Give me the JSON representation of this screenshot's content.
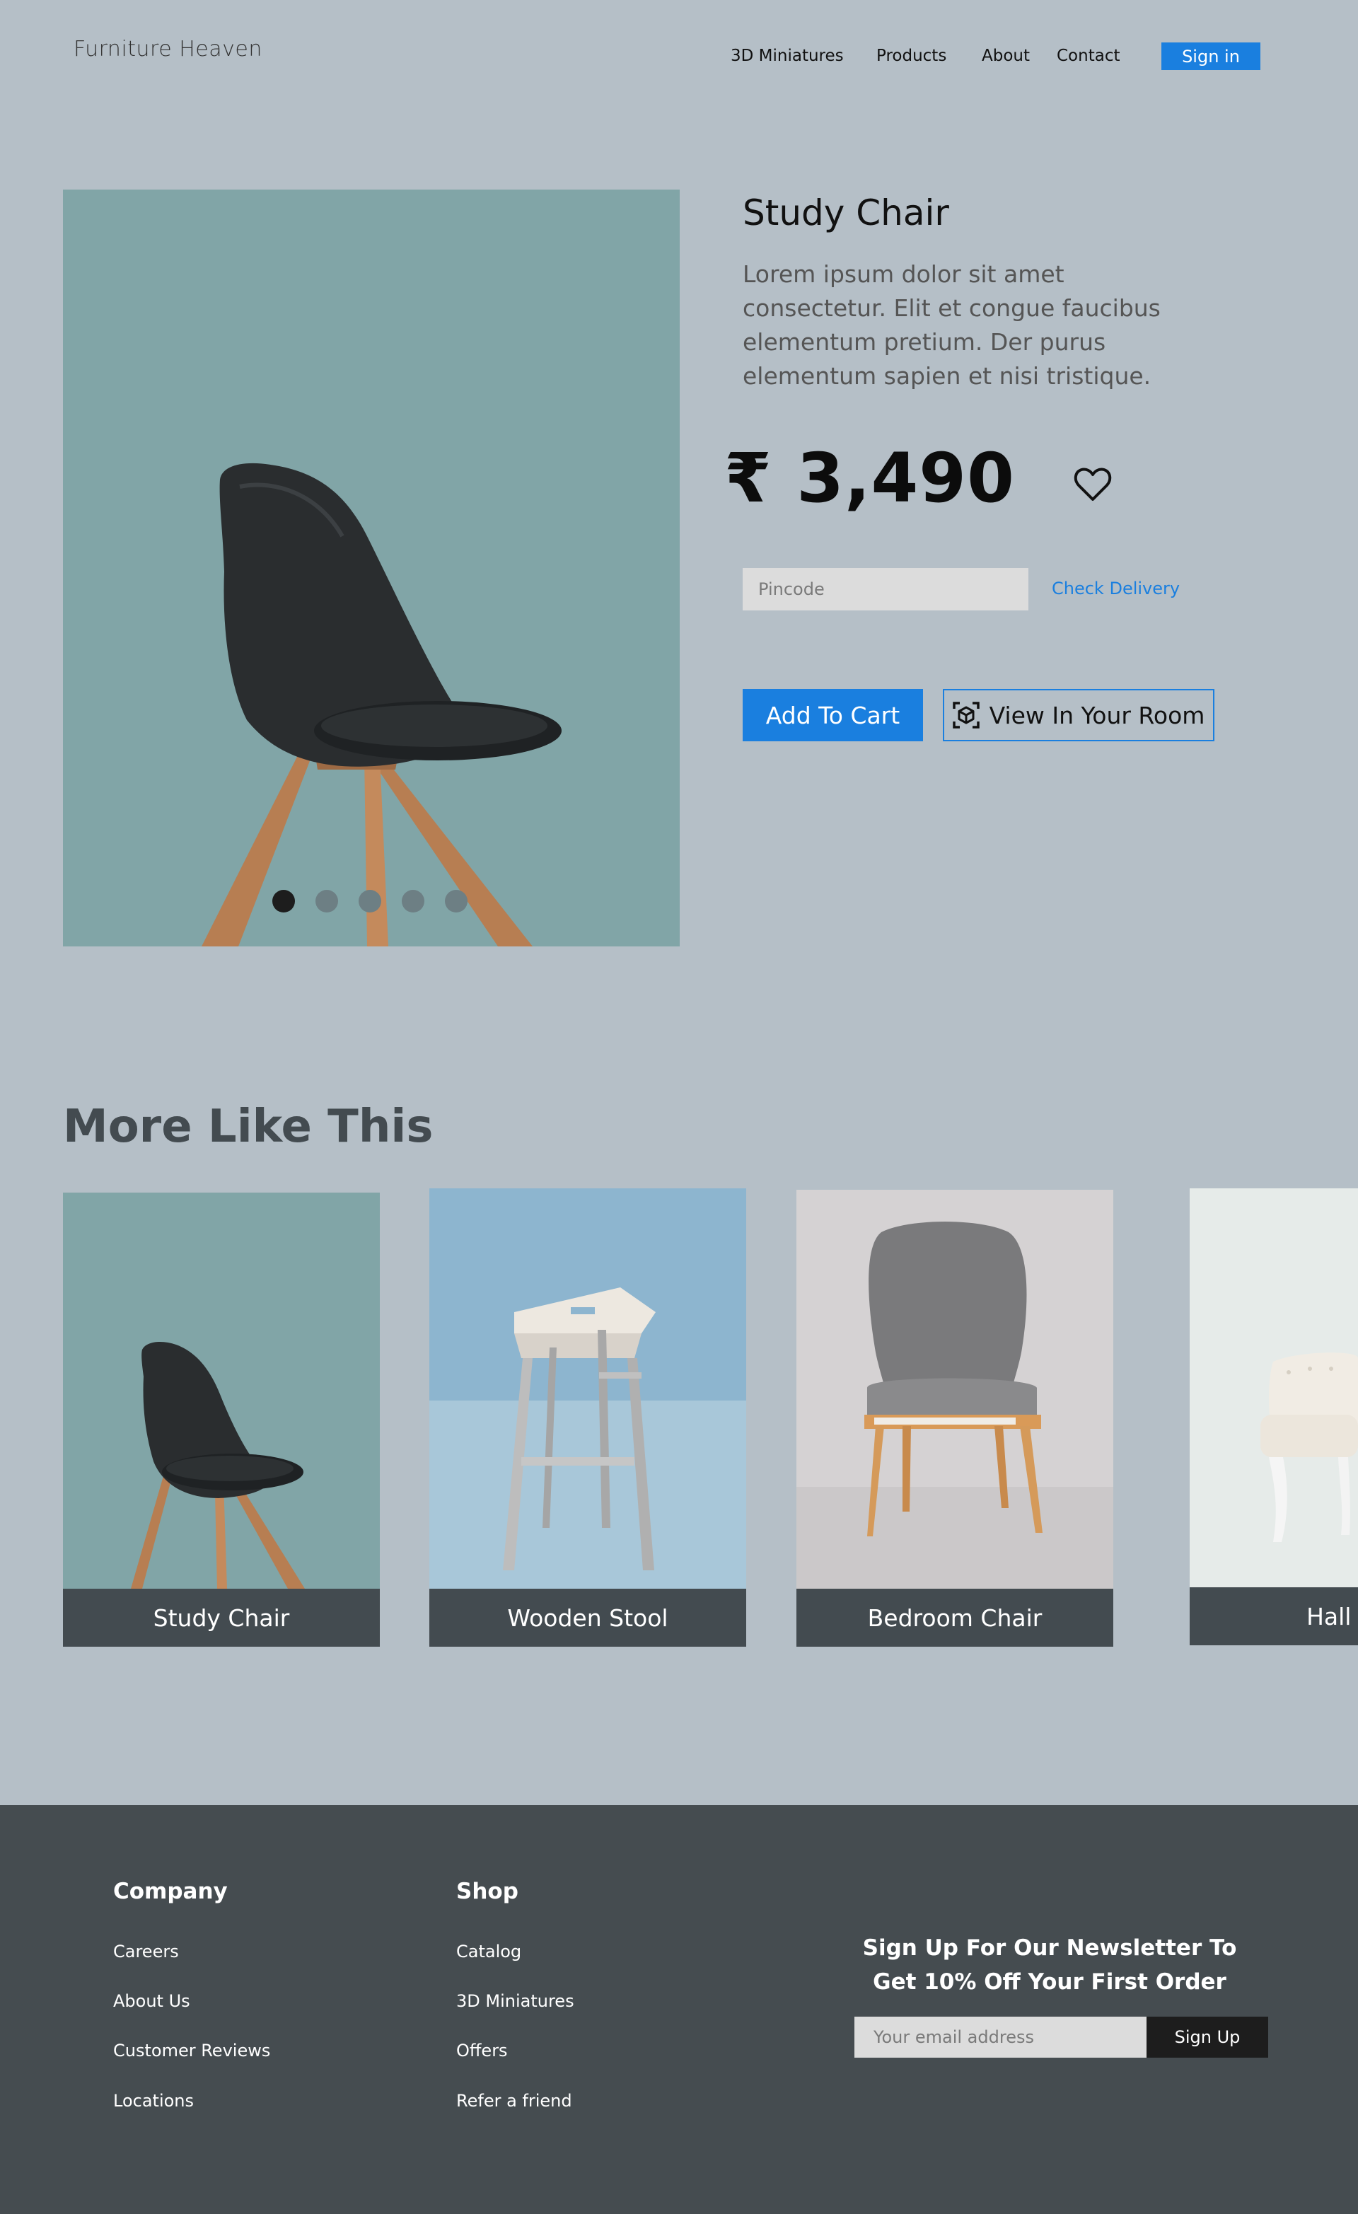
{
  "header": {
    "logo": "Furniture Heaven",
    "nav": [
      "3D Miniatures",
      "Products",
      "About",
      "Contact"
    ],
    "signin": "Sign in"
  },
  "product": {
    "title": "Study Chair",
    "description": "Lorem ipsum dolor sit amet consectetur. Elit et congue faucibus elementum pretium. Der purus elementum sapien et nisi tristique.",
    "price": "₹ 3,490",
    "pincode_placeholder": "Pincode",
    "check_delivery": "Check Delivery",
    "add_to_cart": "Add To Cart",
    "view_in_room": "View In Your Room",
    "carousel_total": 5,
    "carousel_active": 1
  },
  "more": {
    "title": "More Like This",
    "cards": [
      {
        "label": "Study Chair"
      },
      {
        "label": "Wooden Stool"
      },
      {
        "label": "Bedroom Chair"
      },
      {
        "label": "Hall Ch"
      }
    ]
  },
  "footer": {
    "company": {
      "title": "Company",
      "links": [
        "Careers",
        "About Us",
        "Customer Reviews",
        "Locations"
      ]
    },
    "shop": {
      "title": "Shop",
      "links": [
        "Catalog",
        "3D Miniatures",
        "Offers",
        "Refer a friend"
      ]
    },
    "newsletter": {
      "title": "Sign Up For Our Newsletter To Get 10% Off Your First Order",
      "placeholder": "Your email address",
      "button": "Sign Up"
    }
  },
  "colors": {
    "background": "#b5bfc7",
    "accent": "#1a7fdf",
    "footer": "#454c50",
    "card_label": "#434b50"
  }
}
